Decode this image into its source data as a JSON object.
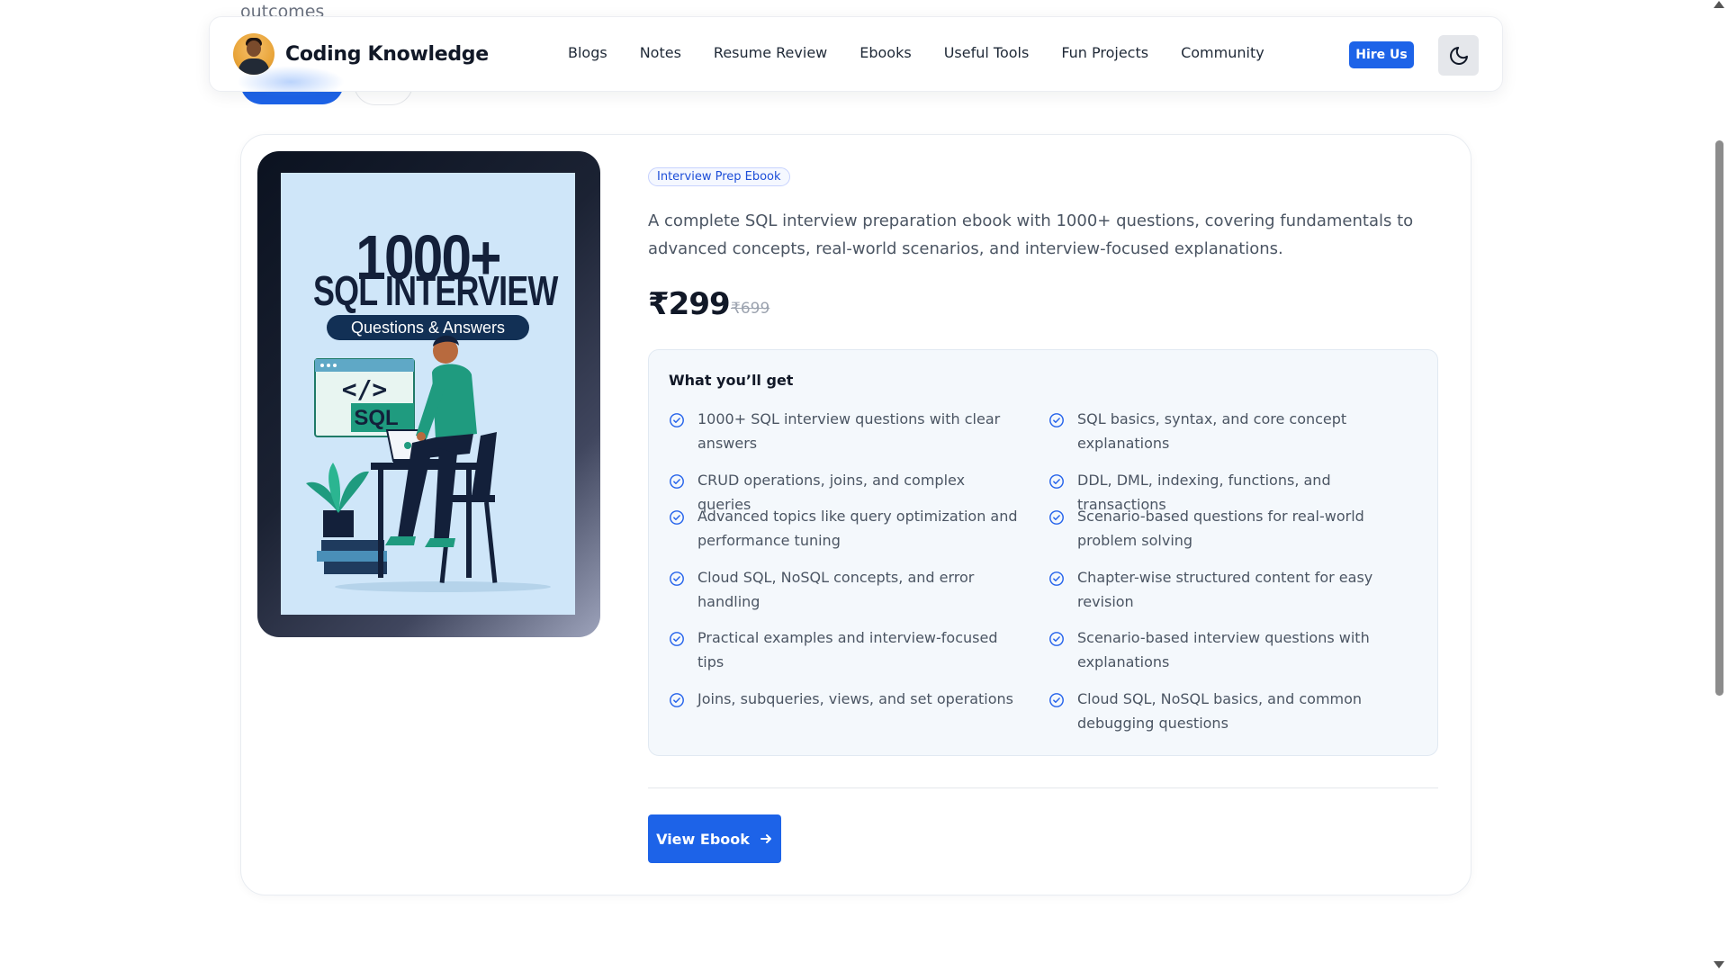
{
  "page_above": {
    "partial_text": "outcomes"
  },
  "header": {
    "brand_name": "Coding Knowledge",
    "nav": [
      {
        "label": "Blogs"
      },
      {
        "label": "Notes"
      },
      {
        "label": "Resume Review"
      },
      {
        "label": "Ebooks"
      },
      {
        "label": "Useful Tools"
      },
      {
        "label": "Fun Projects"
      },
      {
        "label": "Community"
      }
    ],
    "hire_label": "Hire Us",
    "theme_icon": "moon-icon"
  },
  "ebook": {
    "cover": {
      "big_number": "1000+",
      "title": "SQL INTERVIEW",
      "subtitle": "Questions & Answers",
      "code_glyph": "</>",
      "code_label": "SQL"
    },
    "tag": "Interview Prep Ebook",
    "description": "A complete SQL interview preparation ebook with 1000+ questions, covering fundamentals to advanced concepts, real-world scenarios, and interview-focused explanations.",
    "price": "₹299",
    "original_price": "₹699",
    "features_heading": "What you’ll get",
    "features": [
      {
        "text": "1000+ SQL interview questions with clear answers"
      },
      {
        "text": "SQL basics, syntax, and core concept explanations"
      },
      {
        "text": "CRUD operations, joins, and complex queries"
      },
      {
        "text": "DDL, DML, indexing, functions, and transactions"
      },
      {
        "text": "Advanced topics like query optimization and performance tuning"
      },
      {
        "text": "Scenario-based questions for real-world problem solving"
      },
      {
        "text": "Cloud SQL, NoSQL concepts, and error handling"
      },
      {
        "text": "Chapter-wise structured content for easy revision"
      },
      {
        "text": "Practical examples and interview-focused tips"
      },
      {
        "text": "Scenario-based interview questions with explanations"
      },
      {
        "text": "Joins, subqueries, views, and set operations"
      },
      {
        "text": "Cloud SQL, NoSQL basics, and common debugging questions"
      }
    ],
    "cta_label": "View Ebook"
  },
  "colors": {
    "accent": "#1d63e8",
    "check": "#2563eb",
    "cover_bg": "#cfe6f9",
    "cover_navy": "#13203a"
  }
}
